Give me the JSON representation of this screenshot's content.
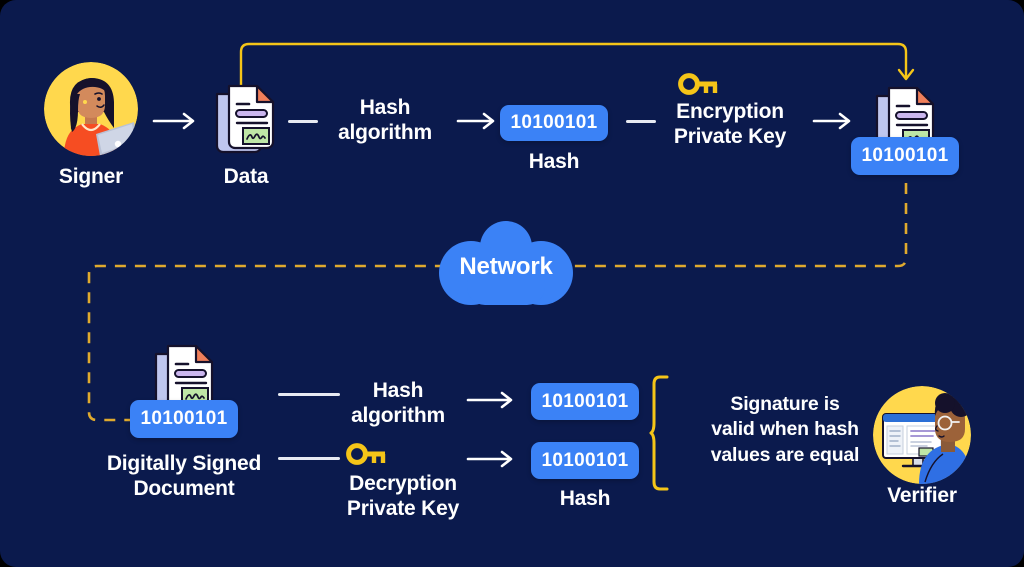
{
  "diagram": {
    "title_implied": "Digital signature process",
    "background_color": "#0b1a4d",
    "accent_blue": "#3b82f6",
    "accent_yellow": "#f5c518",
    "text_color": "#ffffff"
  },
  "top_row": {
    "signer_label": "Signer",
    "data_label": "Data",
    "hash_algorithm_label": "Hash\nalgorithm",
    "hash_badge_value": "10100101",
    "hash_label": "Hash",
    "encryption_key_label": "Encryption\nPrivate Key",
    "signed_doc_badge_value": "10100101"
  },
  "network": {
    "label": "Network"
  },
  "bottom_row": {
    "digitally_signed_label": "Digitally Signed\nDocument",
    "doc_badge_value": "10100101",
    "hash_algorithm_label": "Hash\nalgorithm",
    "decryption_key_label": "Decryption\nPrivate Key",
    "hash_badge_top_value": "10100101",
    "hash_badge_bottom_value": "10100101",
    "hash_label": "Hash",
    "conclusion_text": "Signature is\nvalid when hash\nvalues are equal",
    "verifier_label": "Verifier"
  },
  "icons": {
    "key": "key-icon",
    "document": "document-icon",
    "arrow": "arrow-right-icon",
    "cloud": "cloud-icon",
    "brace": "curly-brace-icon"
  }
}
